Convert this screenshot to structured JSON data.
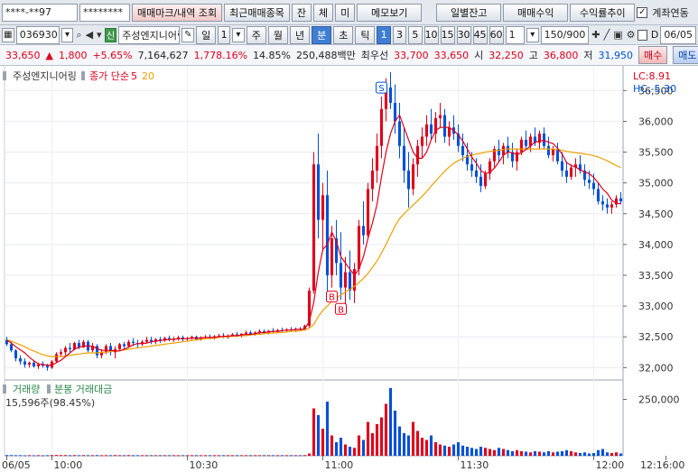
{
  "toolbar": {
    "account_no": "****-**97",
    "password": "********",
    "buttons": [
      "매매마크/내역 조회",
      "최근매매종목",
      "잔",
      "체",
      "미",
      "메모보기",
      "일별잔고",
      "매매수익",
      "수익률추이"
    ],
    "account_link_label": "계좌연동"
  },
  "stock_bar": {
    "code": "036930",
    "badge": "신",
    "name": "주성엔지니어링",
    "period_tabs": [
      "일",
      "1",
      "주",
      "월",
      "년",
      "분",
      "초",
      "틱"
    ],
    "active_tab": "분",
    "minute_options": [
      "1",
      "3",
      "5",
      "10",
      "15",
      "30",
      "45",
      "60"
    ],
    "active_minute": "1",
    "interval": "1",
    "count": "150/900",
    "date": "06/05"
  },
  "quote": {
    "price": "33,650",
    "change_sign": "▲",
    "change": "1,800",
    "change_pct": "+5.65%",
    "volume": "7,164,627",
    "volume_ratio": "1,778.16%",
    "turnover": "14.85%",
    "value": "250,488백만",
    "priority_label": "최우선",
    "ask": "33,700",
    "bid": "33,650",
    "open_label": "시",
    "open": "32,250",
    "high_label": "고",
    "high": "36,800",
    "low_label": "저",
    "low": "31,950",
    "buy_label": "매수",
    "sell_label": "매도"
  },
  "colors": {
    "up": "#e0001b",
    "down": "#0050d8",
    "ma5": "#e0001b",
    "ma20": "#f0a000",
    "volume_label": "#2a8a4a",
    "separator": "#9aa4b2"
  },
  "chart_data": {
    "type": "candlestick",
    "legend_name": "주성엔지니어링",
    "legend_price": "종가 단순",
    "ma_labels": [
      "5",
      "20"
    ],
    "lc_label": "LC:8.91",
    "hc_label": "HC:-5.30",
    "ylim": [
      31800,
      36900
    ],
    "y_ticks": [
      "32,000",
      "32,500",
      "33,000",
      "33,500",
      "34,000",
      "34,500",
      "35,000",
      "35,500",
      "36,000",
      "36,500"
    ],
    "x_ticks": [
      {
        "i": 0,
        "label": "06/05"
      },
      {
        "i": 10,
        "label": "10:00"
      },
      {
        "i": 40,
        "label": "10:30"
      },
      {
        "i": 70,
        "label": "11:00"
      },
      {
        "i": 100,
        "label": "11:30"
      },
      {
        "i": 130,
        "label": "12:00"
      },
      {
        "i": 146,
        "label": "12:16:00"
      }
    ],
    "trade_marks": [
      {
        "i": 72,
        "type": "B",
        "at": "low"
      },
      {
        "i": 74,
        "type": "B",
        "at": "low"
      },
      {
        "i": 83,
        "type": "S",
        "at": "high"
      }
    ],
    "volume_label": "거래량",
    "volume_label_2": "분봉 거래대금",
    "volume_readout": "15,596주(98.45%)",
    "volume_ticks": [
      "250,000"
    ],
    "volume_ylim": [
      0,
      320000
    ],
    "candles": [
      [
        32450,
        32500,
        32350,
        32380
      ],
      [
        32380,
        32420,
        32250,
        32280
      ],
      [
        32280,
        32300,
        32100,
        32150
      ],
      [
        32150,
        32200,
        32050,
        32100
      ],
      [
        32100,
        32150,
        32000,
        32050
      ],
      [
        32050,
        32100,
        32000,
        32080
      ],
      [
        32080,
        32120,
        32000,
        32020
      ],
      [
        32020,
        32080,
        31980,
        32050
      ],
      [
        32050,
        32100,
        32000,
        32030
      ],
      [
        32030,
        32060,
        31950,
        32000
      ],
      [
        32000,
        32120,
        31980,
        32100
      ],
      [
        32100,
        32250,
        32080,
        32220
      ],
      [
        32220,
        32300,
        32180,
        32250
      ],
      [
        32250,
        32350,
        32200,
        32320
      ],
      [
        32320,
        32400,
        32250,
        32300
      ],
      [
        32300,
        32420,
        32280,
        32400
      ],
      [
        32400,
        32450,
        32300,
        32330
      ],
      [
        32330,
        32450,
        32320,
        32420
      ],
      [
        32420,
        32450,
        32250,
        32280
      ],
      [
        32280,
        32400,
        32250,
        32350
      ],
      [
        32350,
        32380,
        32150,
        32200
      ],
      [
        32200,
        32300,
        32150,
        32250
      ],
      [
        32250,
        32380,
        32220,
        32350
      ],
      [
        32350,
        32400,
        32200,
        32250
      ],
      [
        32250,
        32350,
        32150,
        32300
      ],
      [
        32300,
        32400,
        32280,
        32380
      ],
      [
        32380,
        32420,
        32300,
        32350
      ],
      [
        32350,
        32450,
        32330,
        32420
      ],
      [
        32420,
        32480,
        32350,
        32400
      ],
      [
        32400,
        32450,
        32320,
        32380
      ],
      [
        32380,
        32450,
        32350,
        32420
      ],
      [
        32420,
        32500,
        32400,
        32450
      ],
      [
        32450,
        32500,
        32380,
        32420
      ],
      [
        32420,
        32480,
        32380,
        32460
      ],
      [
        32460,
        32500,
        32400,
        32440
      ],
      [
        32440,
        32500,
        32420,
        32480
      ],
      [
        32480,
        32520,
        32430,
        32450
      ],
      [
        32450,
        32500,
        32420,
        32470
      ],
      [
        32470,
        32520,
        32440,
        32490
      ],
      [
        32490,
        32520,
        32430,
        32460
      ],
      [
        32460,
        32500,
        32430,
        32480
      ],
      [
        32480,
        32520,
        32450,
        32500
      ],
      [
        32500,
        32520,
        32440,
        32460
      ],
      [
        32460,
        32510,
        32440,
        32490
      ],
      [
        32490,
        32530,
        32460,
        32500
      ],
      [
        32500,
        32540,
        32470,
        32480
      ],
      [
        32480,
        32530,
        32460,
        32510
      ],
      [
        32510,
        32550,
        32490,
        32520
      ],
      [
        32520,
        32560,
        32480,
        32500
      ],
      [
        32500,
        32540,
        32470,
        32520
      ],
      [
        32520,
        32560,
        32500,
        32540
      ],
      [
        32540,
        32580,
        32500,
        32520
      ],
      [
        32520,
        32560,
        32490,
        32550
      ],
      [
        32550,
        32600,
        32520,
        32570
      ],
      [
        32570,
        32600,
        32520,
        32540
      ],
      [
        32540,
        32590,
        32520,
        32570
      ],
      [
        32570,
        32620,
        32540,
        32590
      ],
      [
        32590,
        32620,
        32550,
        32570
      ],
      [
        32570,
        32610,
        32540,
        32600
      ],
      [
        32600,
        32640,
        32570,
        32590
      ],
      [
        32590,
        32630,
        32560,
        32610
      ],
      [
        32610,
        32650,
        32580,
        32600
      ],
      [
        32600,
        32640,
        32570,
        32620
      ],
      [
        32620,
        32660,
        32590,
        32610
      ],
      [
        32610,
        32650,
        32580,
        32630
      ],
      [
        32630,
        32660,
        32600,
        32620
      ],
      [
        32620,
        32700,
        32600,
        32680
      ],
      [
        32680,
        33300,
        32650,
        33250
      ],
      [
        33250,
        35500,
        33200,
        35300
      ],
      [
        35300,
        35800,
        34100,
        34400
      ],
      [
        34400,
        35000,
        33900,
        34800
      ],
      [
        34800,
        35200,
        33200,
        33500
      ],
      [
        33500,
        34300,
        33300,
        34100
      ],
      [
        34100,
        34400,
        33500,
        33700
      ],
      [
        33700,
        34200,
        33100,
        33300
      ],
      [
        33300,
        33800,
        32950,
        33550
      ],
      [
        33550,
        33900,
        33100,
        33250
      ],
      [
        33250,
        33700,
        33050,
        33600
      ],
      [
        33600,
        34400,
        33500,
        34300
      ],
      [
        34300,
        34700,
        34000,
        34150
      ],
      [
        34150,
        35000,
        34100,
        34900
      ],
      [
        34900,
        35400,
        34700,
        35200
      ],
      [
        35200,
        35800,
        35000,
        35600
      ],
      [
        35600,
        36400,
        35400,
        36200
      ],
      [
        36200,
        36700,
        36000,
        36550
      ],
      [
        36550,
        36800,
        36200,
        36300
      ],
      [
        36300,
        36600,
        35800,
        36000
      ],
      [
        36000,
        36300,
        35400,
        35600
      ],
      [
        35600,
        35900,
        35000,
        35200
      ],
      [
        35200,
        35500,
        34600,
        34900
      ],
      [
        34900,
        35400,
        34800,
        35300
      ],
      [
        35300,
        35700,
        35100,
        35600
      ],
      [
        35600,
        35900,
        35400,
        35750
      ],
      [
        35750,
        36100,
        35600,
        35950
      ],
      [
        35950,
        36200,
        35700,
        35800
      ],
      [
        35800,
        36150,
        35650,
        36050
      ],
      [
        36050,
        36300,
        35900,
        36100
      ],
      [
        36100,
        36200,
        35650,
        35750
      ],
      [
        35750,
        36000,
        35600,
        35900
      ],
      [
        35900,
        36100,
        35700,
        35800
      ],
      [
        35800,
        35950,
        35500,
        35600
      ],
      [
        35600,
        35800,
        35350,
        35450
      ],
      [
        35450,
        35650,
        35200,
        35300
      ],
      [
        35300,
        35500,
        35100,
        35200
      ],
      [
        35200,
        35400,
        35000,
        35100
      ],
      [
        35100,
        35300,
        34850,
        34950
      ],
      [
        34950,
        35200,
        34900,
        35150
      ],
      [
        35150,
        35400,
        35050,
        35350
      ],
      [
        35350,
        35600,
        35250,
        35550
      ],
      [
        35550,
        35700,
        35350,
        35450
      ],
      [
        35450,
        35650,
        35300,
        35600
      ],
      [
        35600,
        35750,
        35400,
        35500
      ],
      [
        35500,
        35650,
        35250,
        35350
      ],
      [
        35350,
        35550,
        35200,
        35500
      ],
      [
        35500,
        35750,
        35450,
        35700
      ],
      [
        35700,
        35850,
        35550,
        35600
      ],
      [
        35600,
        35800,
        35500,
        35750
      ],
      [
        35750,
        35900,
        35600,
        35650
      ],
      [
        35650,
        35850,
        35550,
        35800
      ],
      [
        35800,
        35900,
        35550,
        35600
      ],
      [
        35600,
        35750,
        35400,
        35450
      ],
      [
        35450,
        35600,
        35350,
        35550
      ],
      [
        35550,
        35650,
        35300,
        35350
      ],
      [
        35350,
        35500,
        35100,
        35200
      ],
      [
        35200,
        35350,
        35000,
        35100
      ],
      [
        35100,
        35300,
        35050,
        35250
      ],
      [
        35250,
        35400,
        35100,
        35300
      ],
      [
        35300,
        35450,
        35150,
        35200
      ],
      [
        35200,
        35300,
        34950,
        35050
      ],
      [
        35050,
        35200,
        34900,
        35000
      ],
      [
        35000,
        35150,
        34800,
        34900
      ],
      [
        34900,
        35000,
        34650,
        34700
      ],
      [
        34700,
        34800,
        34550,
        34650
      ],
      [
        34650,
        34750,
        34500,
        34600
      ],
      [
        34600,
        34700,
        34500,
        34650
      ],
      [
        34650,
        34800,
        34600,
        34750
      ],
      [
        34750,
        34850,
        34650,
        34700
      ]
    ],
    "ma5": [
      32450,
      32400,
      32340,
      32290,
      32240,
      32170,
      32110,
      32060,
      32050,
      32040,
      32040,
      32080,
      32120,
      32180,
      32240,
      32300,
      32330,
      32350,
      32350,
      32350,
      32310,
      32280,
      32280,
      32280,
      32270,
      32270,
      32300,
      32330,
      32370,
      32390,
      32390,
      32400,
      32420,
      32430,
      32440,
      32450,
      32460,
      32460,
      32470,
      32470,
      32470,
      32480,
      32480,
      32480,
      32490,
      32490,
      32490,
      32500,
      32510,
      32510,
      32520,
      32520,
      32530,
      32540,
      32540,
      32550,
      32570,
      32570,
      32580,
      32590,
      32590,
      32600,
      32610,
      32610,
      32620,
      32620,
      32630,
      32750,
      33060,
      33550,
      33920,
      34000,
      34200,
      34050,
      33800,
      33700,
      33600,
      33500,
      33600,
      33800,
      34100,
      34350,
      34650,
      35100,
      35500,
      35800,
      36000,
      36100,
      35900,
      35700,
      35500,
      35400,
      35400,
      35500,
      35700,
      35850,
      35900,
      35900,
      35900,
      35850,
      35780,
      35680,
      35550,
      35420,
      35320,
      35200,
      35150,
      35170,
      35240,
      35340,
      35450,
      35500,
      35490,
      35460,
      35490,
      35540,
      35600,
      35660,
      35680,
      35690,
      35660,
      35640,
      35560,
      35470,
      35330,
      35280,
      35260,
      35210,
      35180,
      35150,
      35090,
      35000,
      34900,
      34830,
      34720,
      34670,
      34660
    ],
    "ma20": [
      32450,
      32430,
      32400,
      32370,
      32340,
      32300,
      32270,
      32240,
      32210,
      32190,
      32180,
      32180,
      32180,
      32190,
      32200,
      32210,
      32220,
      32230,
      32240,
      32240,
      32240,
      32250,
      32250,
      32260,
      32270,
      32280,
      32290,
      32300,
      32310,
      32320,
      32330,
      32340,
      32350,
      32360,
      32370,
      32380,
      32390,
      32400,
      32410,
      32420,
      32430,
      32440,
      32450,
      32460,
      32470,
      32470,
      32480,
      32490,
      32500,
      32500,
      32510,
      32510,
      32520,
      32520,
      32530,
      32540,
      32540,
      32550,
      32560,
      32560,
      32570,
      32570,
      32580,
      32590,
      32590,
      32600,
      32610,
      32640,
      32700,
      32830,
      32930,
      33000,
      33080,
      33130,
      33180,
      33230,
      33270,
      33320,
      33380,
      33450,
      33530,
      33630,
      33730,
      33860,
      34000,
      34150,
      34300,
      34420,
      34500,
      34570,
      34640,
      34710,
      34780,
      34860,
      34950,
      35030,
      35110,
      35190,
      35260,
      35320,
      35360,
      35400,
      35430,
      35450,
      35470,
      35480,
      35500,
      35510,
      35520,
      35530,
      35540,
      35550,
      35550,
      35550,
      35550,
      35550,
      35550,
      35550,
      35550,
      35550,
      35550,
      35550,
      35540,
      35530,
      35510,
      35500,
      35490,
      35480,
      35470,
      35460,
      35440,
      35420,
      35390,
      35360,
      35320,
      35280,
      35250
    ],
    "volumes": [
      3000,
      3000,
      2500,
      2500,
      2000,
      2500,
      2000,
      2500,
      2000,
      2500,
      3000,
      3500,
      3000,
      3000,
      2500,
      3000,
      2500,
      3000,
      2500,
      2500,
      3000,
      2500,
      2500,
      2500,
      3000,
      2500,
      2500,
      3000,
      2500,
      2500,
      2500,
      2500,
      2500,
      2500,
      2500,
      2500,
      2500,
      2500,
      2500,
      2500,
      2500,
      2500,
      2500,
      2500,
      2500,
      2500,
      2500,
      2500,
      2500,
      2500,
      2500,
      2500,
      2500,
      2500,
      2500,
      2500,
      2500,
      2500,
      2500,
      2500,
      2500,
      2500,
      2500,
      2500,
      2500,
      2500,
      3000,
      10000,
      210000,
      180000,
      120000,
      240000,
      90000,
      60000,
      80000,
      50000,
      40000,
      35000,
      90000,
      70000,
      150000,
      100000,
      140000,
      170000,
      230000,
      300000,
      200000,
      130000,
      100000,
      90000,
      150000,
      110000,
      80000,
      70000,
      90000,
      60000,
      50000,
      45000,
      40000,
      50000,
      60000,
      45000,
      40000,
      35000,
      30000,
      40000,
      35000,
      30000,
      25000,
      35000,
      30000,
      25000,
      20000,
      25000,
      20000,
      18000,
      15000,
      20000,
      18000,
      15000,
      20000,
      15000,
      18000,
      20000,
      25000,
      20000,
      15000,
      12000,
      15000,
      10000,
      12000,
      25000,
      30000,
      15000,
      12000,
      15000,
      10000
    ]
  }
}
